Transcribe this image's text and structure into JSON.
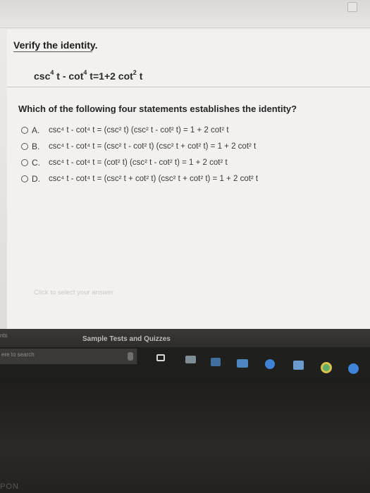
{
  "page": {
    "title": "Verify the identity.",
    "identity": {
      "lhs1": "csc",
      "p1": "4",
      "t1": "t",
      "minus": "-",
      "lhs2": "cot",
      "p2": "4",
      "t2": "t",
      "eq": "=",
      "rhs": "1+2 cot",
      "p3": "2",
      "t3": "t"
    },
    "question": "Which of the following four statements establishes the identity?",
    "options": [
      {
        "letter": "A.",
        "expr": "csc⁴ t - cot⁴ t = (csc² t) (csc² t - cot² t) = 1 + 2 cot² t"
      },
      {
        "letter": "B.",
        "expr": "csc⁴ t - cot⁴ t = (csc² t - cot² t) (csc² t + cot² t) = 1 + 2 cot² t"
      },
      {
        "letter": "C.",
        "expr": "csc⁴ t - cot⁴ t = (cot² t) (csc² t - cot² t) = 1 + 2 cot² t"
      },
      {
        "letter": "D.",
        "expr": "csc⁴ t - cot⁴ t = (csc² t + cot² t) (csc² t + cot² t) = 1 + 2 cot² t"
      }
    ],
    "hint": "Click to select your answer"
  },
  "lower": {
    "side_label": "nts",
    "sample_link": "Sample Tests and Quizzes"
  },
  "taskbar": {
    "search_placeholder": "ere to search",
    "icons": [
      "microphone-icon",
      "task-view-icon",
      "file-explorer-icon",
      "store-icon",
      "mail-icon",
      "edge-icon",
      "app-icon",
      "chrome-icon",
      "media-icon"
    ]
  },
  "bezel": {
    "text": "PON"
  },
  "colors": {
    "screen_bg": "#ecebea",
    "taskbar": "#1f1f1e",
    "accent_blue": "#3f83d6"
  }
}
